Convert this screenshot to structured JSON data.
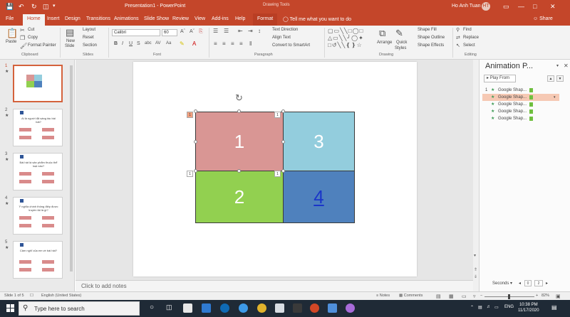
{
  "titlebar": {
    "doc_title": "Presentation1 - PowerPoint",
    "context_group": "Drawing Tools",
    "user_name": "Ho Anh Tuan",
    "user_initials": "HT"
  },
  "tabs": [
    "File",
    "Home",
    "Insert",
    "Design",
    "Transitions",
    "Animations",
    "Slide Show",
    "Review",
    "View",
    "Add-ins",
    "Help",
    "Format"
  ],
  "tell_me": "Tell me what you want to do",
  "share": "Share",
  "ribbon": {
    "clipboard": {
      "paste": "Paste",
      "cut": "Cut",
      "copy": "Copy",
      "format_painter": "Format Painter",
      "label": "Clipboard"
    },
    "slides": {
      "new_slide": "New",
      "new_slide_2": "Slide",
      "layout": "Layout",
      "reset": "Reset",
      "section": "Section",
      "label": "Slides"
    },
    "font": {
      "name": "Calibri",
      "size": "60",
      "label": "Font"
    },
    "paragraph": {
      "text_direction": "Text Direction",
      "align_text": "Align Text",
      "convert_smartart": "Convert to SmartArt",
      "label": "Paragraph"
    },
    "drawing": {
      "arrange": "Arrange",
      "quick_styles": "Quick",
      "quick_styles_2": "Styles",
      "shape_fill": "Shape Fill",
      "shape_outline": "Shape Outline",
      "shape_effects": "Shape Effects",
      "label": "Drawing"
    },
    "editing": {
      "find": "Find",
      "replace": "Replace",
      "select": "Select",
      "label": "Editing"
    }
  },
  "thumbnails": [
    {
      "number": "1",
      "question": ""
    },
    {
      "number": "2",
      "question": "Ai là người đã sáng tác bài hát?"
    },
    {
      "number": "3",
      "question": "Bài hát là sản phẩm thuộc thể loại nào?"
    },
    {
      "number": "4",
      "question": "Ý nghĩa chính thông điệp được truyền tải là gì?"
    },
    {
      "number": "5",
      "question": "Cảm nghĩ của em về bài hát?"
    }
  ],
  "slide": {
    "tiles": [
      "1",
      "3",
      "2",
      "4"
    ],
    "anim_badges": [
      "1",
      "1",
      "1",
      "1"
    ]
  },
  "notes_placeholder": "Click to add notes",
  "animation_pane": {
    "title": "Animation P...",
    "play_from": "Play From",
    "items": [
      {
        "num": "1",
        "label": "Google Shap..."
      },
      {
        "num": "",
        "label": "Google Shap..."
      },
      {
        "num": "",
        "label": "Google Shap..."
      },
      {
        "num": "",
        "label": "Google Shap..."
      },
      {
        "num": "",
        "label": "Google Shap..."
      }
    ],
    "seconds_label": "Seconds",
    "sec_start": "0",
    "sec_end": "2"
  },
  "status": {
    "slide_info": "Slide 1 of 5",
    "language": "English (United States)",
    "notes": "Notes",
    "comments": "Comments",
    "zoom": "82%"
  },
  "taskbar": {
    "search_placeholder": "Type here to search",
    "lang": "ENG",
    "time": "10:38 PM",
    "date": "11/17/2020"
  },
  "colors": {
    "accent": "#c4462a",
    "tile_1": "#d99694",
    "tile_3": "#93cddd",
    "tile_2": "#92d050",
    "tile_4": "#4f81bd",
    "tile_4_text": "#1a35c9",
    "selected_anim": "#f6c9b4"
  }
}
